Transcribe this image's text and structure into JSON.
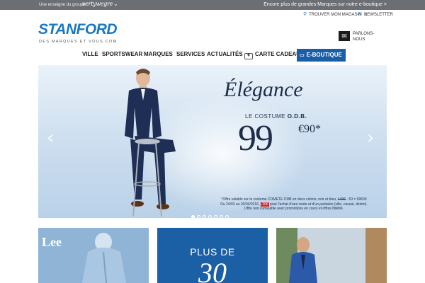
{
  "topbar": {
    "group_label": "Une enseigne du groupe",
    "group_name": "vertywegre",
    "caret": "⌄",
    "promo": "Encore plus de grandes Marques sur notre e-boutique >"
  },
  "utility": {
    "store_finder": "TROUVER MON MAGASIN",
    "store_count": "1",
    "newsletter": "NEWSLETTER",
    "contact_line1": "PARLONS-",
    "contact_line2": "NOUS"
  },
  "brand": {
    "logo": "STANFORD",
    "tagline": "DES MARQUES ET VOUS.COM"
  },
  "nav": {
    "items": [
      "VILLE",
      "SPORTSWEAR",
      "MARQUES",
      "SERVICES",
      "ACTUALITÉS",
      "CARTE CADEAU",
      "E-BOUTIQUE"
    ]
  },
  "hero": {
    "title": "Élégance",
    "subtitle_prefix": "LE COSTUME",
    "subtitle_brand": "O.D.B.",
    "price_main": "99",
    "price_cents": "€90*",
    "fine_1": "*Offre valable sur le costume COMETE ODB en deux coloris, noir et bleu,",
    "fine_1_old": "149€",
    "fine_1_old_b": "- 50",
    "fine_1_new": "= 99€90",
    "fine_2_a": "Du 24/03 au 30/04/2016,",
    "fine_2_badge": "-20€",
    "fine_2_b": "pour l'achat d'une veste et d'un pantalon (ville, casual, denim).",
    "fine_3": "Offre non cumulable avec promotions en cours et offres fidélité.",
    "prev_arrow": "‹",
    "next_arrow": "›",
    "slides": 7,
    "active_slide": 1
  },
  "tiles": {
    "lee": "Lee",
    "plus_de": "PLUS DE",
    "thirty": "30"
  },
  "colors": {
    "topbar": "#6b6e72",
    "brand_blue": "#1a78c2",
    "eboutique": "#195ea8",
    "promo_red": "#d2232a"
  }
}
